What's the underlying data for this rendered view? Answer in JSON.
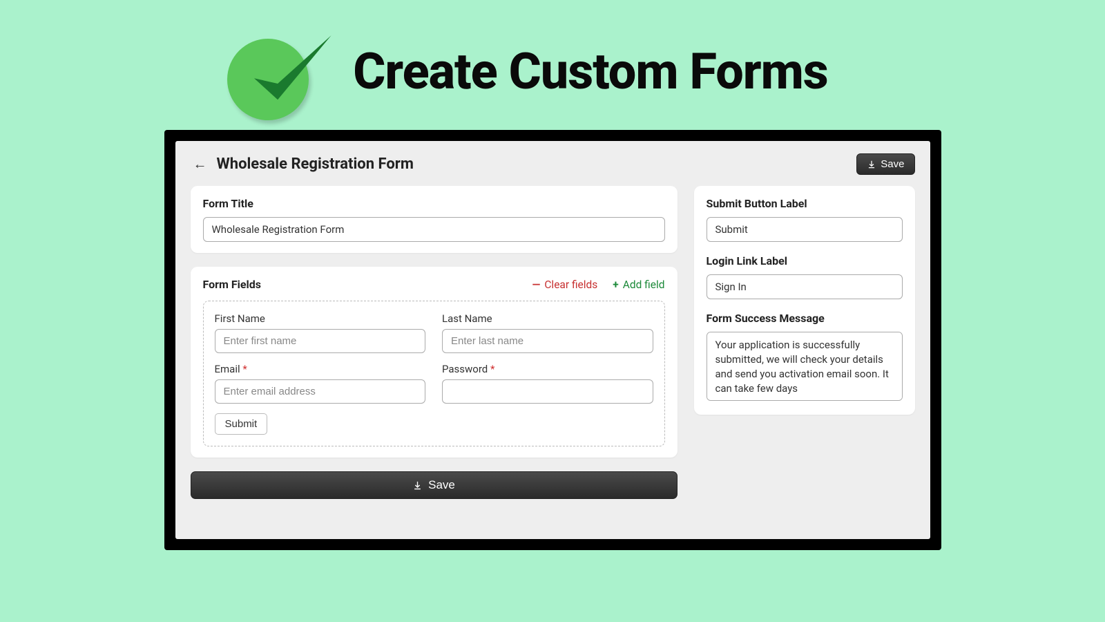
{
  "hero": {
    "title": "Create Custom Forms"
  },
  "header": {
    "page_title": "Wholesale Registration Form",
    "save_label": "Save"
  },
  "main": {
    "form_title_label": "Form Title",
    "form_title_value": "Wholesale Registration Form",
    "form_fields_label": "Form Fields",
    "clear_fields_label": "Clear fields",
    "add_field_label": "Add field",
    "fields": [
      {
        "label": "First Name",
        "placeholder": "Enter first name",
        "required": false
      },
      {
        "label": "Last Name",
        "placeholder": "Enter last name",
        "required": false
      },
      {
        "label": "Email",
        "placeholder": "Enter email address",
        "required": true
      },
      {
        "label": "Password",
        "placeholder": "",
        "required": true
      }
    ],
    "preview_submit_label": "Submit",
    "save_bottom_label": "Save"
  },
  "sidebar": {
    "submit_button_label_title": "Submit Button Label",
    "submit_button_label_value": "Submit",
    "login_link_label_title": "Login Link Label",
    "login_link_label_value": "Sign In",
    "success_message_title": "Form Success Message",
    "success_message_value": "Your application is successfully submitted, we will check your details and send you activation email soon. It can take few days"
  }
}
